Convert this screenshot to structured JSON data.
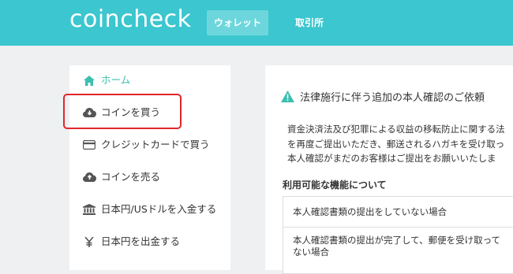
{
  "header": {
    "logo": "coincheck",
    "tabs": [
      {
        "label": "ウォレット"
      },
      {
        "label": "取引所"
      }
    ]
  },
  "sidebar": {
    "items": [
      {
        "label": "ホーム",
        "icon": "home-icon"
      },
      {
        "label": "コインを買う",
        "icon": "cloud-download-icon"
      },
      {
        "label": "クレジットカードで買う",
        "icon": "credit-card-icon"
      },
      {
        "label": "コインを売る",
        "icon": "cloud-upload-icon"
      },
      {
        "label": "日本円/USドルを入金する",
        "icon": "bank-icon"
      },
      {
        "label": "日本円を出金する",
        "icon": "yen-icon"
      }
    ]
  },
  "main": {
    "notice_title": "法律施行に伴う追加の本人確認のご依頼",
    "body_lines": [
      "資金決済法及び犯罪による収益の移転防止に関する法",
      "を再度ご提出いただき、郵送されるハガキを受け取っ",
      "本人確認がまだのお客様はご提出をお願いいたしま"
    ],
    "features_title": "利用可能な機能について",
    "features": [
      {
        "lines": [
          "本人確認書類の提出をしていない場合"
        ]
      },
      {
        "lines": [
          "本人確認書類の提出が完了して、郵便を受け取って",
          "ない場合"
        ]
      }
    ]
  },
  "colors": {
    "header_bg": "#3cc6cf",
    "active_tab_bg": "#6dd6dc",
    "home_accent": "#3cbfae",
    "highlight_border": "#e0262b"
  }
}
